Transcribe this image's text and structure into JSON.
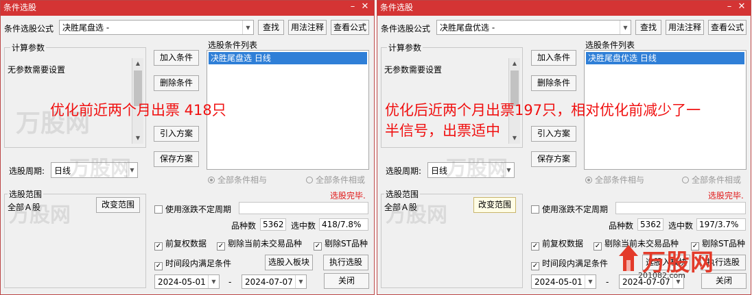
{
  "windows": [
    {
      "title": "条件选股",
      "formula_label": "条件选股公式",
      "formula_value": "决胜尾盘选  -",
      "find_label": "查找",
      "usage_label": "用法注释",
      "view_label": "查看公式",
      "params_title": "计算参数",
      "params_text": "无参数需要设置",
      "add_label": "加入条件",
      "delete_label": "删除条件",
      "import_label": "引入方案",
      "save_label": "保存方案",
      "list_title": "选股条件列表",
      "list_items": [
        "决胜尾盘选  日线"
      ],
      "period_label": "选股周期:",
      "period_value": "日线",
      "radio_and": "全部条件相与",
      "radio_or": "全部条件相或",
      "scope_title": "选股范围",
      "scope_value": "全部Ａ股",
      "change_scope_label": "改变范围",
      "status_text": "选股完毕.",
      "use_uncertain_label": "使用涨跌不定周期",
      "variety_label": "品种数",
      "variety_value": "5362",
      "selected_label": "选中数",
      "selected_value": "418/7.8%",
      "fq_label": "前复权数据",
      "exclude_untraded_label": "剔除当前未交易品种",
      "exclude_st_label": "剔除ST品种",
      "period_cond_label": "时间段内满足条件",
      "to_block_label": "选股入板块",
      "execute_label": "执行选股",
      "date_from": "2024-05-01",
      "date_sep": "-",
      "date_to": "2024-07-07",
      "close_label": "关闭",
      "overlay_lines": [
        "优化前近两个月出票 418只"
      ]
    },
    {
      "title": "条件选股",
      "formula_label": "条件选股公式",
      "formula_value": "决胜尾盘优选  -",
      "find_label": "查找",
      "usage_label": "用法注释",
      "view_label": "查看公式",
      "params_title": "计算参数",
      "params_text": "无参数需要设置",
      "add_label": "加入条件",
      "delete_label": "删除条件",
      "import_label": "引入方案",
      "save_label": "保存方案",
      "list_title": "选股条件列表",
      "list_items": [
        "决胜尾盘优选  日线"
      ],
      "period_label": "选股周期:",
      "period_value": "日线",
      "radio_and": "全部条件相与",
      "radio_or": "全部条件相或",
      "scope_title": "选股范围",
      "scope_value": "全部Ａ股",
      "change_scope_label": "改变范围",
      "status_text": "选股完毕.",
      "use_uncertain_label": "使用涨跌不定周期",
      "variety_label": "品种数",
      "variety_value": "5362",
      "selected_label": "选中数",
      "selected_value": "197/3.7%",
      "fq_label": "前复权数据",
      "exclude_untraded_label": "剔除当前未交易品种",
      "exclude_st_label": "剔除ST品种",
      "period_cond_label": "时间段内满足条件",
      "to_block_label": "选股入板块",
      "execute_label": "执行选股",
      "date_from": "2024-05-01",
      "date_sep": "-",
      "date_to": "2024-07-07",
      "close_label": "关闭",
      "overlay_lines": [
        "优化后近两个月出票197只，相对优化前减少了一",
        "半信号，出票适中"
      ]
    }
  ],
  "watermark": {
    "logo_text": "万股网",
    "url": "201082.com",
    "colors": {
      "title_bar": "#d43434",
      "overlay_text": "#f01010",
      "selection": "#2f7fd7"
    }
  }
}
